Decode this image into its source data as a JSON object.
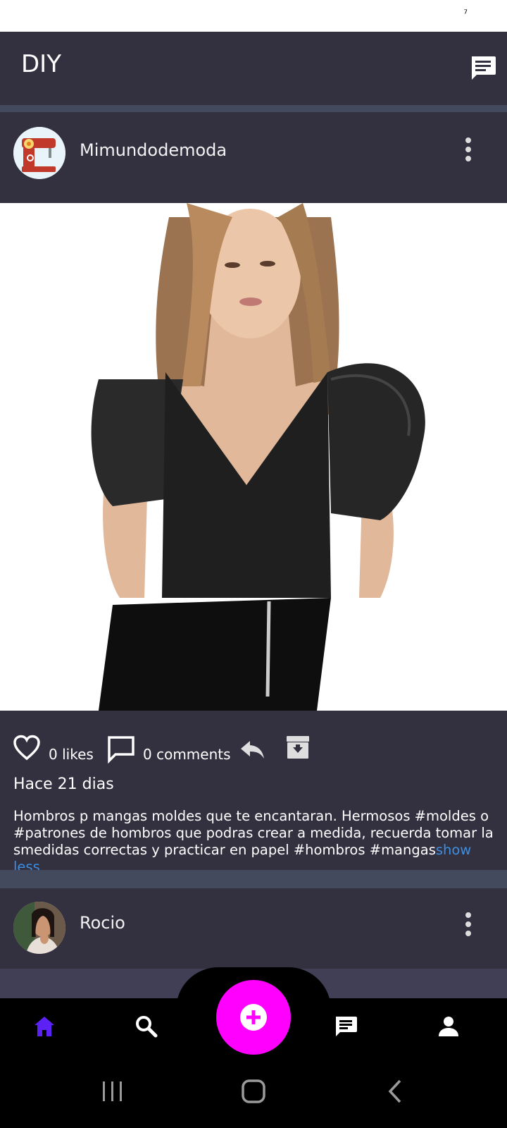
{
  "status_bar": {
    "glyph": "⁷"
  },
  "app_bar": {
    "title": "DIY",
    "chat_icon": "chat-bubble-icon"
  },
  "posts": [
    {
      "username": "Mimundodemoda",
      "likes": "0 likes",
      "comments": "0 comments",
      "time": "Hace 21 dias",
      "description": "Hombros p mangas moldes  que te encantaran. Hermosos #moldes o #patrones de hombros que podras crear a medida, recuerda tomar la smedidas correctas y practicar en papel #hombros #mangas",
      "toggle": "show less"
    },
    {
      "username": "Rocio"
    }
  ],
  "bottom_nav": {
    "active": "home",
    "active_color": "#5b21f5",
    "fab_color": "#ff00ff",
    "items": [
      "home-icon",
      "search-icon",
      "add-icon",
      "chat-icon",
      "profile-icon"
    ]
  },
  "colors": {
    "card": "#333040",
    "divider": "#434a5e",
    "link": "#3d8fe0"
  }
}
